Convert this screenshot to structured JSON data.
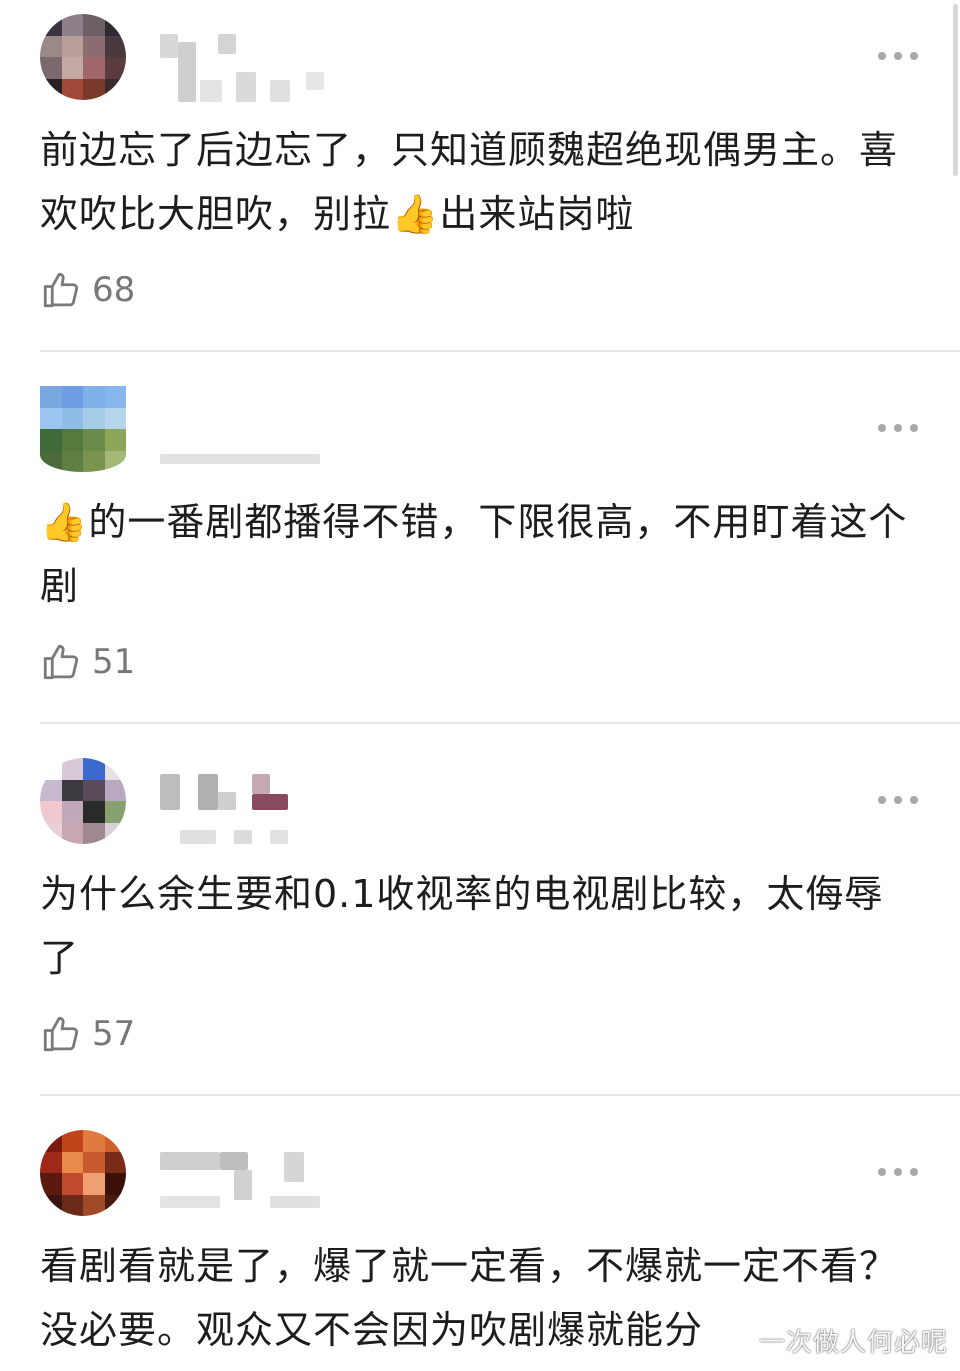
{
  "comments": [
    {
      "text": "前边忘了后边忘了，只知道顾魏超绝现偶男主。喜欢吹比大胆吹，别拉👍出来站岗啦",
      "likes": "68",
      "avatar_palette": [
        "#3a3340",
        "#8e7f8a",
        "#6c5f66",
        "#2e2a31",
        "#9a8a86",
        "#b89f9c",
        "#8a6c72",
        "#4a3a40",
        "#7a6a6e",
        "#c4a8a4",
        "#a0666a",
        "#5a3c3e",
        "#2a2024",
        "#a04a3a",
        "#7a3a2a",
        "#3a2a2a"
      ]
    },
    {
      "text": "👍的一番剧都播得不错，下限很高，不用盯着这个剧",
      "likes": "51",
      "avatar_palette": [
        "#7aa6e0",
        "#6e9ee2",
        "#7fb0ea",
        "#86b6ee",
        "#9cc6ef",
        "#8fbde8",
        "#a6cde8",
        "#b5d6ea",
        "#3f6b3a",
        "#547a3e",
        "#6a8b4a",
        "#8da65a",
        "#4a6a3a",
        "#5e7e42",
        "#7a9450",
        "#a6b878"
      ]
    },
    {
      "text": "为什么余生要和0.1收视率的电视剧比较，太侮辱了",
      "likes": "57",
      "avatar_palette": [
        "#ffffff",
        "#d8c8d8",
        "#3a6ad0",
        "#e8e0e8",
        "#c8b8d0",
        "#3a3a40",
        "#5a4a5a",
        "#b8a8c0",
        "#f0c8d0",
        "#c0a8b8",
        "#2a2a2a",
        "#88a070",
        "#e8d0d8",
        "#c8a8b0",
        "#a08890",
        "#d8d0d8"
      ]
    },
    {
      "text": "看剧看就是了，爆了就一定看，不爆就一定不看？没必要。观众又不会因为吹剧爆就能分",
      "likes": "",
      "avatar_palette": [
        "#7a1a10",
        "#c0451a",
        "#e07a40",
        "#d0602a",
        "#a02818",
        "#e88a4a",
        "#c85a30",
        "#7a2a18",
        "#5a1a10",
        "#c04a30",
        "#f0a070",
        "#3a1008",
        "#3a1410",
        "#6a2a18",
        "#a04a28",
        "#4a1a10"
      ]
    }
  ],
  "watermark": "一次做人何必呢",
  "icons": {
    "more": "more-dots-icon",
    "like": "thumbs-up-icon"
  }
}
